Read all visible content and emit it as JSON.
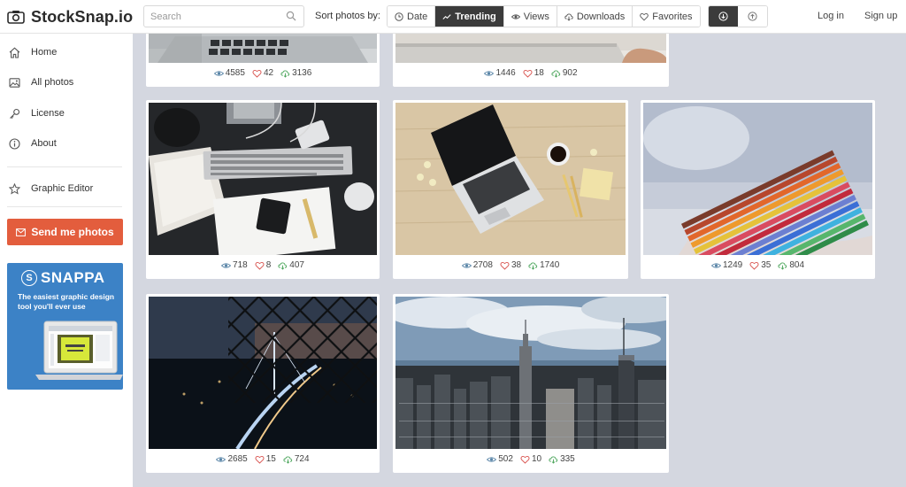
{
  "header": {
    "logo_text": "StockSnap.io",
    "search": {
      "placeholder": "Search",
      "value": ""
    },
    "sort_label": "Sort photos by:",
    "sort_options": [
      "Date",
      "Trending",
      "Views",
      "Downloads",
      "Favorites"
    ],
    "active_sort": "Trending",
    "view_modes": [
      "download-circle-icon",
      "upload-circle-icon"
    ],
    "login": "Log in",
    "signup": "Sign up"
  },
  "sidebar": {
    "items": [
      {
        "label": "Home",
        "icon": "home-icon"
      },
      {
        "label": "All photos",
        "icon": "image-icon"
      },
      {
        "label": "License",
        "icon": "key-icon"
      },
      {
        "label": "About",
        "icon": "info-icon"
      },
      {
        "label": "Graphic Editor",
        "icon": "star-icon"
      }
    ],
    "send_button": "Send me photos",
    "ad": {
      "brand_initial": "S",
      "brand": "SNAPPA",
      "tagline": "The easiest graphic design tool you'll ever use"
    }
  },
  "photos": [
    {
      "subject": "laptop-keyboard",
      "views": "4585",
      "likes": "42",
      "downloads": "3136"
    },
    {
      "subject": "desk-laptop-hand",
      "views": "1446",
      "likes": "18",
      "downloads": "902"
    },
    {
      "subject": "dark-desk-workspace",
      "views": "718",
      "likes": "8",
      "downloads": "407"
    },
    {
      "subject": "laptop-wood-desk",
      "views": "2708",
      "likes": "38",
      "downloads": "1740"
    },
    {
      "subject": "colored-pencils",
      "views": "1249",
      "likes": "35",
      "downloads": "804"
    },
    {
      "subject": "bridge-through-fence",
      "views": "2685",
      "likes": "15",
      "downloads": "724"
    },
    {
      "subject": "new-york-skyline",
      "views": "502",
      "likes": "10",
      "downloads": "335"
    }
  ],
  "colors": {
    "accent": "#e35d3d",
    "active_sort_bg": "#3b3b3b",
    "content_bg": "#d4d7e0",
    "ad_bg": "#3c82c6"
  }
}
